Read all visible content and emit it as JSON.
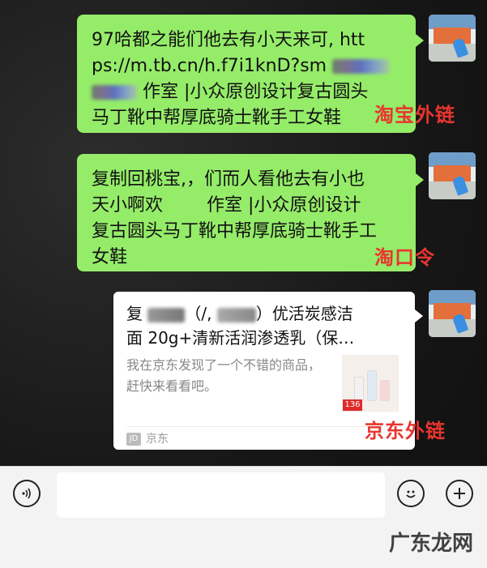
{
  "messages": {
    "m1": {
      "line1": "97哈都之能们他去有小天来可,   htt",
      "line2": "ps://m.tb.cn/h.f7i1knD?sm",
      "line3a": "作室 |小众原创设计复古圆头",
      "line4": "马丁靴中帮厚底骑士靴手工女鞋"
    },
    "m2": {
      "line1": "复制回桃宝,，们而人看他去有小也",
      "line2a": "天小啊欢",
      "line2b": "作室 |小众原创设计",
      "line3": "复古圆头马丁靴中帮厚底骑士靴手工",
      "line4": "女鞋"
    }
  },
  "card": {
    "title_pre": "复",
    "title_post": "优活炭感洁",
    "title_line2": "面 20g+清新活润渗透乳（保…",
    "desc": "我在京东发现了一个不错的商品，赶快来看看吧。",
    "thumb_badge": "136",
    "source_logo": "JD",
    "source": "京东"
  },
  "annotations": {
    "taobao_link": "淘宝外链",
    "taobao_code": "淘口令",
    "jd_link": "京东外链"
  },
  "input_bar": {
    "voice_icon": "voice-icon",
    "emoji_icon": "emoji-icon",
    "plus_icon": "plus-icon",
    "text_value": ""
  },
  "watermark": "广东龙网",
  "colors": {
    "bubble_green": "#95ec69",
    "annotation_red": "#e8352f",
    "card_bg": "#ffffff"
  }
}
